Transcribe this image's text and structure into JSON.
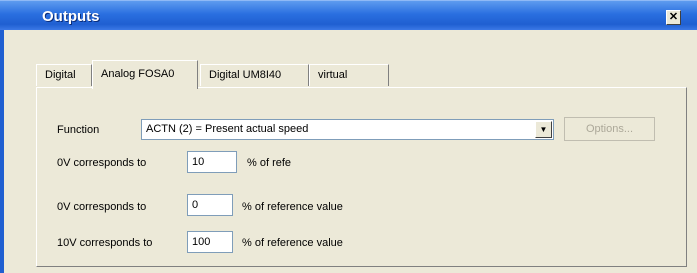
{
  "window": {
    "title": "Outputs",
    "close_label": "✕"
  },
  "tabs": [
    {
      "label": "Digital"
    },
    {
      "label": "Analog FOSA0"
    },
    {
      "label": "Digital UM8I40"
    },
    {
      "label": "virtual"
    }
  ],
  "function": {
    "label": "Function",
    "selected": "ACTN (2) = Present actual speed",
    "options_button": "Options..."
  },
  "rows": [
    {
      "label": "0V corresponds to",
      "value": "10",
      "suffix": "% of refe"
    },
    {
      "label": "0V corresponds to",
      "value": "0",
      "suffix": "% of reference value"
    },
    {
      "label": "10V corresponds to",
      "value": "100",
      "suffix": "% of reference value"
    }
  ]
}
